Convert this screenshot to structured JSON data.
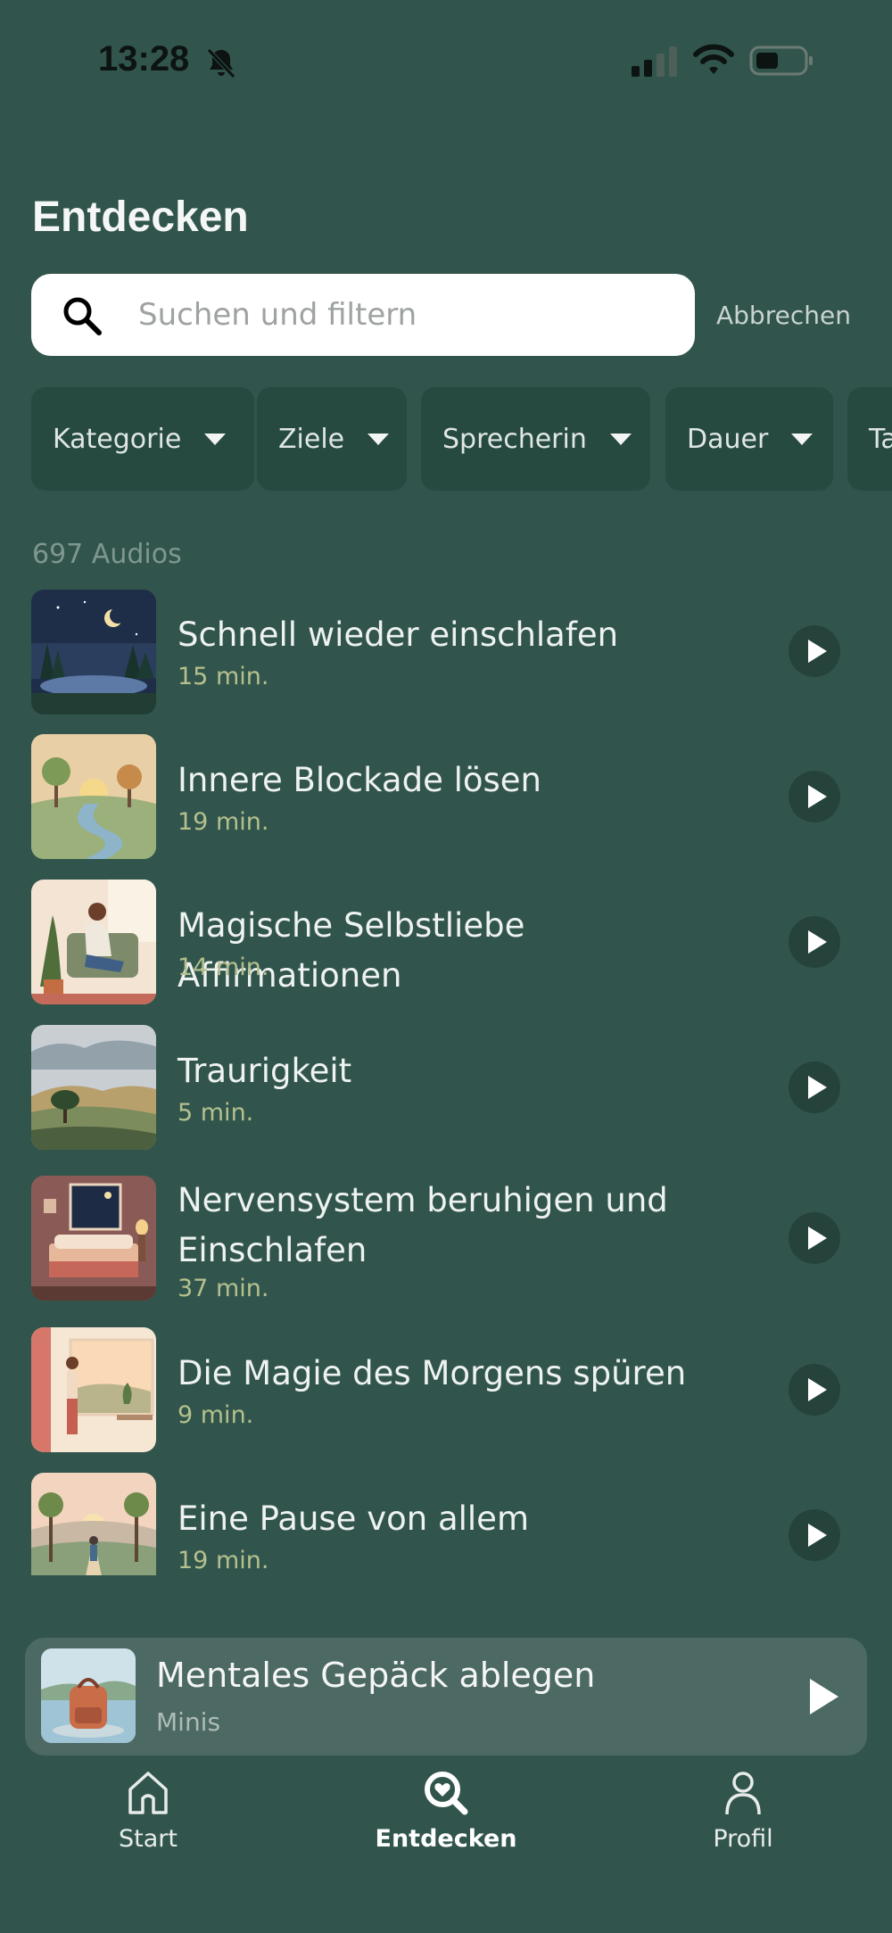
{
  "status_bar": {
    "time": "13:28"
  },
  "header": {
    "title": "Entdecken"
  },
  "search": {
    "placeholder": "Suchen und filtern",
    "value": "",
    "cancel_label": "Abbrechen"
  },
  "filters": [
    {
      "label": "Kategorie"
    },
    {
      "label": "Ziele"
    },
    {
      "label": "Sprecherin"
    },
    {
      "label": "Dauer"
    },
    {
      "label": "Ta"
    }
  ],
  "results": {
    "count_label": "697 Audios",
    "items": [
      {
        "title": "Schnell wieder einschlafen",
        "duration": "15 min."
      },
      {
        "title": " Innere Blockade lösen",
        "duration": "19 min."
      },
      {
        "title": "Magische Selbstliebe Affirmationen",
        "duration": "14 min."
      },
      {
        "title": "Traurigkeit",
        "duration": "5 min."
      },
      {
        "title": "Nervensystem beruhigen und Einschlafen",
        "duration": "37 min."
      },
      {
        "title": "Die Magie des Morgens spüren",
        "duration": "9 min."
      },
      {
        "title": "Eine Pause von allem",
        "duration": "19 min."
      }
    ]
  },
  "now_playing": {
    "title": "Mentales Gepäck ablegen",
    "subtitle": "Minis"
  },
  "tabbar": {
    "items": [
      {
        "label": "Start",
        "icon": "home-icon"
      },
      {
        "label": "Entdecken",
        "icon": "discover-icon",
        "active": true
      },
      {
        "label": "Profil",
        "icon": "profile-icon"
      }
    ]
  },
  "colors": {
    "background": "#31554c",
    "chip": "#264a40",
    "duration": "#b4c08e",
    "mini_player": "#4d6963"
  }
}
